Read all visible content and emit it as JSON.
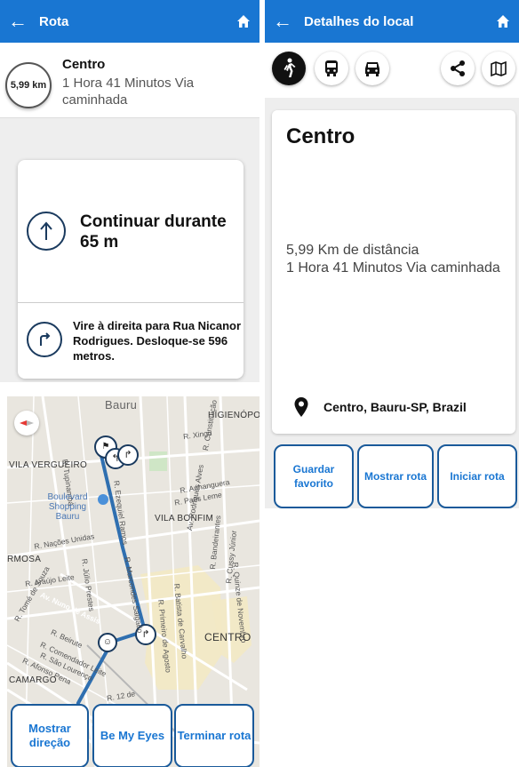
{
  "route_screen": {
    "title": "Rota",
    "back_icon": "arrow-left-icon",
    "home_icon": "home-icon",
    "distance_badge": "5,99 km",
    "destination": "Centro",
    "duration": "1 Hora 41 Minutos Via caminhada",
    "current_instruction": "Continuar durante 65 m",
    "next_instruction": "Vire à direita para Rua Nicanor Rodrigues. Desloque-se 596 metros."
  },
  "map": {
    "labels": {
      "bauru": "Bauru",
      "higienopolis": "HIGIENÓPOL",
      "vila_vergueiro": "VILA VERGUEIRO",
      "xingu": "R. Xingu",
      "constituicao": "R. Constituição",
      "ezequiel": "R. Ezequiel Ramos",
      "tupinamba": "R. Tupinambá",
      "anhanguera": "R. Anhanguera",
      "paes_leme": "R. Paes Leme",
      "boulevard": "Boulevard Shopping Bauru",
      "vila_bonfim": "VILA BONFIM",
      "nacoes": "R. Nações Unidas",
      "rmosa": "RMOSA",
      "araujo": "R. Araújo Leite",
      "julio": "R. Júlio Prestes",
      "marcondes": "R. Marcondes Salgado",
      "rodrigues_alves": "Av. Rodrigues Alves",
      "nuno": "Av. Nuno de Assis",
      "beirute": "R. Beirute",
      "comendador": "R. Comendador Leite",
      "sao_lourenco": "R. São Lourenço",
      "afonso": "R. Afonso Pena",
      "torres": "R. Tomé de Souza",
      "camargo": "CAMARGO",
      "primeiro": "R. Primeiro de Agosto",
      "batista": "R. Batista de Carvalho",
      "bandeirantes": "R. Bandeirantes",
      "cussy": "R. Cussy Júnior",
      "quinze": "R. Quinze de Novembro",
      "centro": "CENTRO",
      "doze": "R. 12 de"
    },
    "buttons": {
      "show_direction": "Mostrar direção",
      "be_my_eyes": "Be My Eyes",
      "end_route": "Terminar rota"
    }
  },
  "details_screen": {
    "title": "Detalhes do local",
    "modes": [
      "walk-icon",
      "bus-icon",
      "car-icon"
    ],
    "share_icon": "share-icon",
    "map_icon": "map-icon",
    "place_name": "Centro",
    "distance_text": "5,99 Km de distância",
    "duration_text": "1 Hora 41 Minutos Via caminhada",
    "address": "Centro, Bauru-SP, Brazil",
    "buttons": {
      "save_favorite": "Guardar favorito",
      "show_route": "Mostrar rota",
      "start_route": "Iniciar rota"
    }
  },
  "colors": {
    "appbar": "#1976d2",
    "button_text": "#1976d2",
    "route_line": "#2f6fb0",
    "map_background": "#e9e6df"
  }
}
